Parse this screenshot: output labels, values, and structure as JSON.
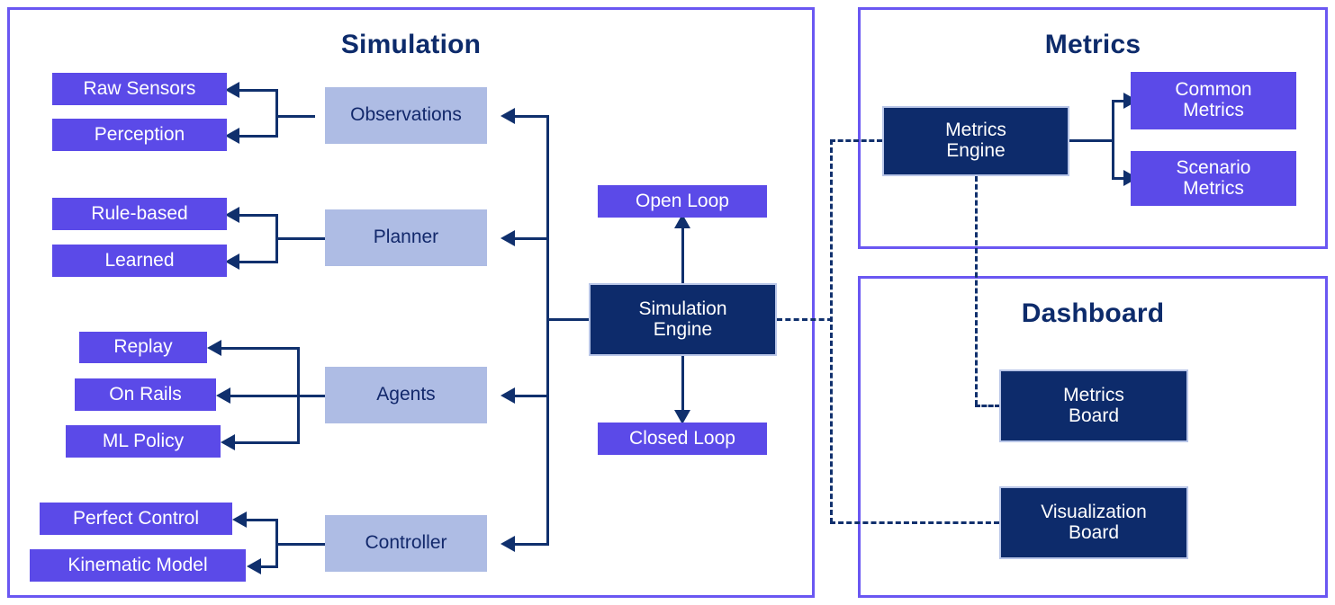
{
  "panels": {
    "simulation": {
      "title": "Simulation"
    },
    "metrics": {
      "title": "Metrics"
    },
    "dashboard": {
      "title": "Dashboard"
    }
  },
  "nodes": {
    "raw_sensors": "Raw Sensors",
    "perception": "Perception",
    "observations": "Observations",
    "rule_based": "Rule-based",
    "learned": "Learned",
    "planner": "Planner",
    "replay": "Replay",
    "on_rails": "On Rails",
    "ml_policy": "ML Policy",
    "agents": "Agents",
    "perfect_control": "Perfect Control",
    "kinematic_model": "Kinematic Model",
    "controller": "Controller",
    "open_loop": "Open Loop",
    "closed_loop": "Closed Loop",
    "simulation_engine": "Simulation\nEngine",
    "metrics_engine": "Metrics\nEngine",
    "common_metrics": "Common\nMetrics",
    "scenario_metrics": "Scenario\nMetrics",
    "metrics_board": "Metrics\nBoard",
    "visualization_board": "Visualization\nBoard"
  },
  "colors": {
    "panel_border": "#6a57f2",
    "purple_node": "#5b4ae8",
    "navy_node": "#0d2b6b",
    "steel_node": "#aebce4",
    "connector": "#10306d",
    "title_text": "#0d2b6b",
    "background": "#ffffff"
  },
  "chart_data": {
    "type": "diagram",
    "title": "Simulation / Metrics / Dashboard architecture block diagram",
    "groups": [
      {
        "name": "Simulation",
        "blocks": [
          "Raw Sensors",
          "Perception",
          "Observations",
          "Rule-based",
          "Learned",
          "Planner",
          "Replay",
          "On Rails",
          "ML Policy",
          "Agents",
          "Perfect Control",
          "Kinematic Model",
          "Controller",
          "Open Loop",
          "Closed Loop",
          "Simulation Engine"
        ]
      },
      {
        "name": "Metrics",
        "blocks": [
          "Metrics Engine",
          "Common Metrics",
          "Scenario Metrics"
        ]
      },
      {
        "name": "Dashboard",
        "blocks": [
          "Metrics Board",
          "Visualization Board"
        ]
      }
    ],
    "edges": [
      {
        "from": "Simulation Engine",
        "to": "Observations",
        "style": "solid"
      },
      {
        "from": "Simulation Engine",
        "to": "Planner",
        "style": "solid"
      },
      {
        "from": "Simulation Engine",
        "to": "Agents",
        "style": "solid"
      },
      {
        "from": "Simulation Engine",
        "to": "Controller",
        "style": "solid"
      },
      {
        "from": "Observations",
        "to": "Raw Sensors",
        "style": "solid"
      },
      {
        "from": "Observations",
        "to": "Perception",
        "style": "solid"
      },
      {
        "from": "Planner",
        "to": "Rule-based",
        "style": "solid"
      },
      {
        "from": "Planner",
        "to": "Learned",
        "style": "solid"
      },
      {
        "from": "Agents",
        "to": "Replay",
        "style": "solid"
      },
      {
        "from": "Agents",
        "to": "On Rails",
        "style": "solid"
      },
      {
        "from": "Agents",
        "to": "ML Policy",
        "style": "solid"
      },
      {
        "from": "Controller",
        "to": "Perfect Control",
        "style": "solid"
      },
      {
        "from": "Controller",
        "to": "Kinematic Model",
        "style": "solid"
      },
      {
        "from": "Simulation Engine",
        "to": "Open Loop",
        "style": "solid",
        "direction": "up"
      },
      {
        "from": "Simulation Engine",
        "to": "Closed Loop",
        "style": "solid",
        "direction": "down"
      },
      {
        "from": "Simulation Engine",
        "to": "Metrics Engine",
        "style": "dashed"
      },
      {
        "from": "Simulation Engine",
        "to": "Visualization Board",
        "style": "dashed"
      },
      {
        "from": "Metrics Engine",
        "to": "Metrics Board",
        "style": "dashed"
      },
      {
        "from": "Metrics Engine",
        "to": "Common Metrics",
        "style": "solid"
      },
      {
        "from": "Metrics Engine",
        "to": "Scenario Metrics",
        "style": "solid"
      }
    ]
  }
}
